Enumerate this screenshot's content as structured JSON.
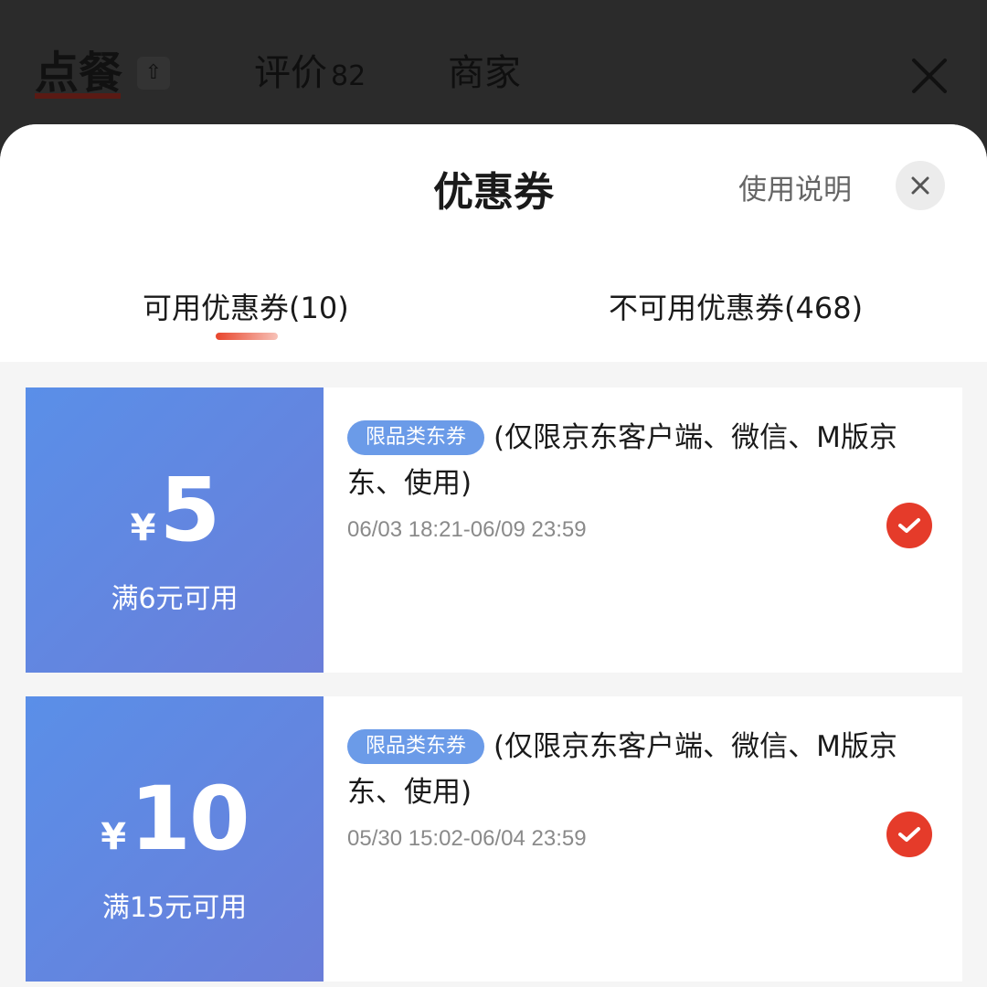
{
  "topbar": {
    "tabs": [
      {
        "label": "点餐"
      },
      {
        "label": "评价",
        "count": "82"
      },
      {
        "label": "商家"
      }
    ],
    "arrow_icon": "⇧"
  },
  "sheet": {
    "title": "优惠券",
    "usage_link": "使用说明",
    "tabs": [
      {
        "label": "可用优惠券(10)"
      },
      {
        "label": "不可用优惠券(468)"
      }
    ],
    "accent_color": "#e8452c"
  },
  "coupons": [
    {
      "currency": "¥",
      "amount": "5",
      "threshold": "满6元可用",
      "tag": "限品类东券",
      "description": "(仅限京东客户端、微信、M版京东、使用)",
      "validity": "06/03 18:21-06/09 23:59",
      "selected": true
    },
    {
      "currency": "¥",
      "amount": "10",
      "threshold": "满15元可用",
      "tag": "限品类东券",
      "description": "(仅限京东客户端、微信、M版京东、使用)",
      "validity": "05/30 15:02-06/04 23:59",
      "selected": true
    }
  ]
}
